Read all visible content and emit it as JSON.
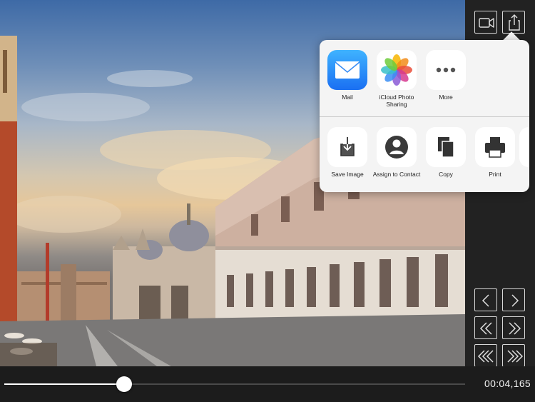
{
  "share_sheet": {
    "apps": [
      {
        "label": "Mail",
        "icon": "mail-icon"
      },
      {
        "label": "iCloud Photo Sharing",
        "icon": "photos-icon"
      },
      {
        "label": "More",
        "icon": "more-icon"
      }
    ],
    "actions": [
      {
        "label": "Save Image",
        "icon": "save-image-icon"
      },
      {
        "label": "Assign to Contact",
        "icon": "contact-icon"
      },
      {
        "label": "Copy",
        "icon": "copy-icon"
      },
      {
        "label": "Print",
        "icon": "print-icon"
      }
    ]
  },
  "toolbar": {
    "top_buttons": [
      "video-camera-icon",
      "share-icon"
    ],
    "nav_buttons": [
      "chevron-left-icon",
      "chevron-right-icon",
      "double-chevron-left-icon",
      "double-chevron-right-icon",
      "triple-chevron-left-icon",
      "triple-chevron-right-icon"
    ]
  },
  "playback": {
    "timestamp": "00:04,165",
    "progress": 0.26
  },
  "colors": {
    "panel": "#222222",
    "bar": "#1c1c1c",
    "sheet": "#f4f4f4",
    "mail_blue": "#1d8cf8"
  }
}
